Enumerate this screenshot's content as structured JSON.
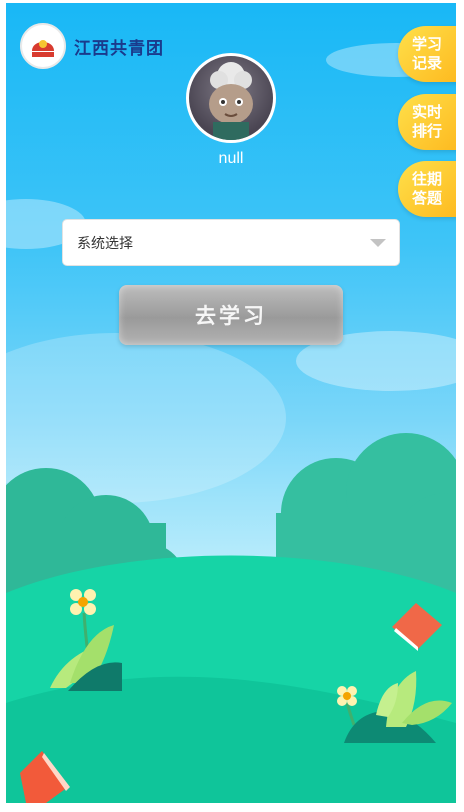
{
  "header": {
    "logo_text": "江西共青团"
  },
  "user": {
    "name": "null"
  },
  "side_buttons": [
    {
      "line1": "学习",
      "line2": "记录"
    },
    {
      "line1": "实时",
      "line2": "排行"
    },
    {
      "line1": "往期",
      "line2": "答题"
    }
  ],
  "form": {
    "select_value": "系统选择"
  },
  "actions": {
    "go_label": "去学习"
  },
  "colors": {
    "sky_top": "#19b8f6",
    "grass": "#0fc59a",
    "badge": "#fdb81e",
    "logo_red": "#d83b2f"
  }
}
